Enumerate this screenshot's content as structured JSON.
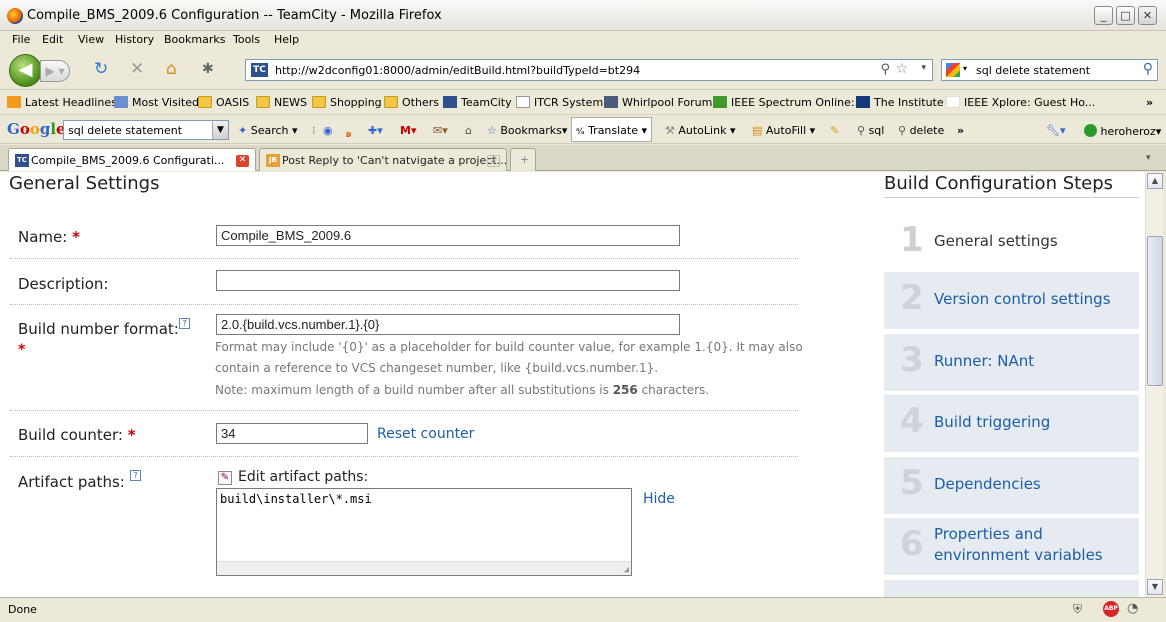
{
  "window": {
    "title": "Compile_BMS_2009.6 Configuration -- TeamCity - Mozilla Firefox"
  },
  "menu": [
    "File",
    "Edit",
    "View",
    "History",
    "Bookmarks",
    "Tools",
    "Help"
  ],
  "nav": {
    "url": "http://w2dconfig01:8000/admin/editBuild.html?buildTypeId=bt294",
    "search_value": "sql delete statement"
  },
  "bookmarks": [
    "Latest Headlines",
    "Most Visited",
    "OASIS",
    "NEWS",
    "Shopping",
    "Others",
    "TeamCity",
    "ITCR System",
    "Whirlpool Forums",
    "IEEE Spectrum Online:...",
    "The Institute",
    "IEEE Xplore: Guest Ho..."
  ],
  "google_toolbar": {
    "logo": "Google",
    "query": "sql delete statement",
    "search": "Search",
    "bookmarks": "Bookmarks",
    "translate": "Translate",
    "autolink": "AutoLink",
    "autofill": "AutoFill",
    "sql": "sql",
    "delete": "delete",
    "user": "heroheroz"
  },
  "tabs": [
    {
      "label": "Compile_BMS_2009.6 Configurati..."
    },
    {
      "label": "Post Reply to 'Can't natvigate a project..."
    }
  ],
  "form": {
    "heading": "General Settings",
    "name_label": "Name:",
    "name_value": "Compile_BMS_2009.6",
    "description_label": "Description:",
    "description_value": "",
    "build_number_label": "Build number format:",
    "build_number_value": "2.0.{build.vcs.number.1}.{0}",
    "hint_line1": "Format may include '{0}' as a placeholder for build counter value, for example 1.{0}. It may also",
    "hint_line2": "contain a reference to VCS changeset number, like {build.vcs.number.1}.",
    "hint_line3_a": "Note: maximum length of a build number after all substitutions is ",
    "hint_line3_b": "256",
    "hint_line3_c": " characters.",
    "build_counter_label": "Build counter:",
    "build_counter_value": "34",
    "reset_counter": "Reset counter",
    "artifact_label": "Artifact paths:",
    "edit_artifact_paths": "Edit artifact paths:",
    "artifact_value": "build\\installer\\*.msi",
    "hide": "Hide",
    "required_mark": "*",
    "help_mark": "?"
  },
  "steps": {
    "heading": "Build Configuration Steps",
    "items": [
      {
        "num": "1",
        "label": "General settings"
      },
      {
        "num": "2",
        "label": "Version control settings"
      },
      {
        "num": "3",
        "label": "Runner: NAnt"
      },
      {
        "num": "4",
        "label": "Build triggering"
      },
      {
        "num": "5",
        "label": "Dependencies"
      },
      {
        "num": "6",
        "label": "Properties and environment variables"
      }
    ]
  },
  "status": {
    "text": "Done",
    "abp": "ABP"
  }
}
